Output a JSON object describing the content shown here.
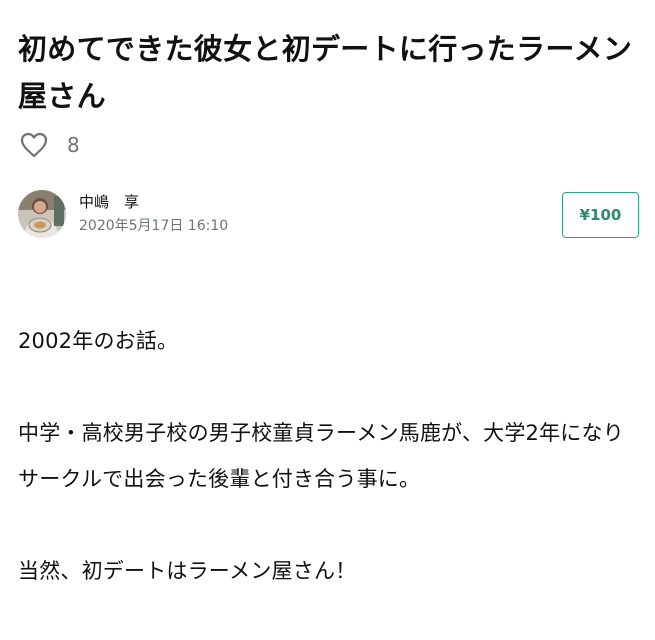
{
  "article": {
    "title": "初めてできた彼女と初デートに行ったラーメン屋さん",
    "like_icon": "heart-outline-icon",
    "like_count": "8",
    "author_name": "中嶋　享",
    "post_date": "2020年5月17日 16:10",
    "price_label": "¥100",
    "paragraphs": [
      "2002年のお話。",
      "中学・高校男子校の男子校童貞ラーメン馬鹿が、大学2年になりサークルで出会った後輩と付き合う事に。",
      "当然、初デートはラーメン屋さん！"
    ]
  },
  "colors": {
    "accent": "#2fa281",
    "muted_text": "#707575",
    "text": "#111111"
  }
}
